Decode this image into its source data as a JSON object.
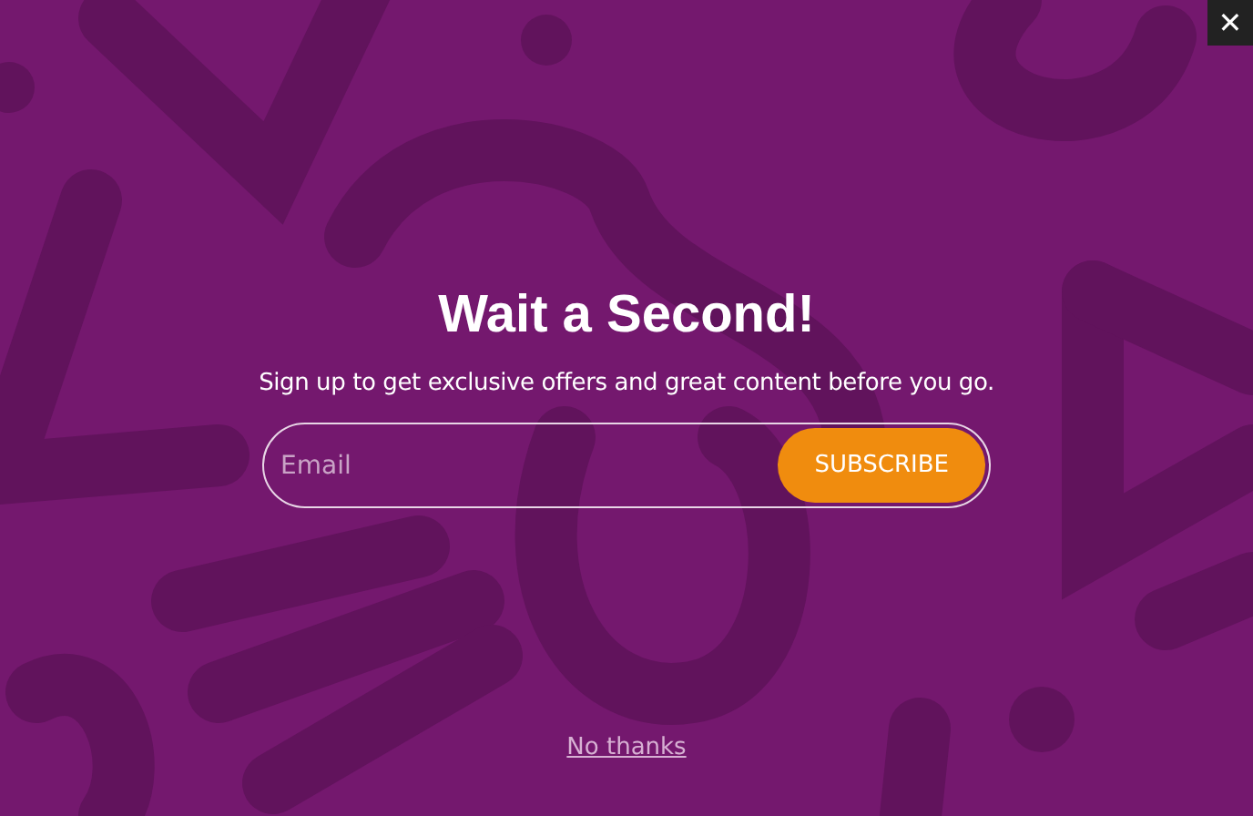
{
  "close_button": {
    "label": "✕"
  },
  "title": "Wait a Second!",
  "subtitle": "Sign up to get exclusive offers and great content before you go.",
  "email_field": {
    "placeholder": "Email"
  },
  "subscribe_button": {
    "label": "SUBSCRIBE"
  },
  "dismiss_link": {
    "label": "No thanks"
  }
}
